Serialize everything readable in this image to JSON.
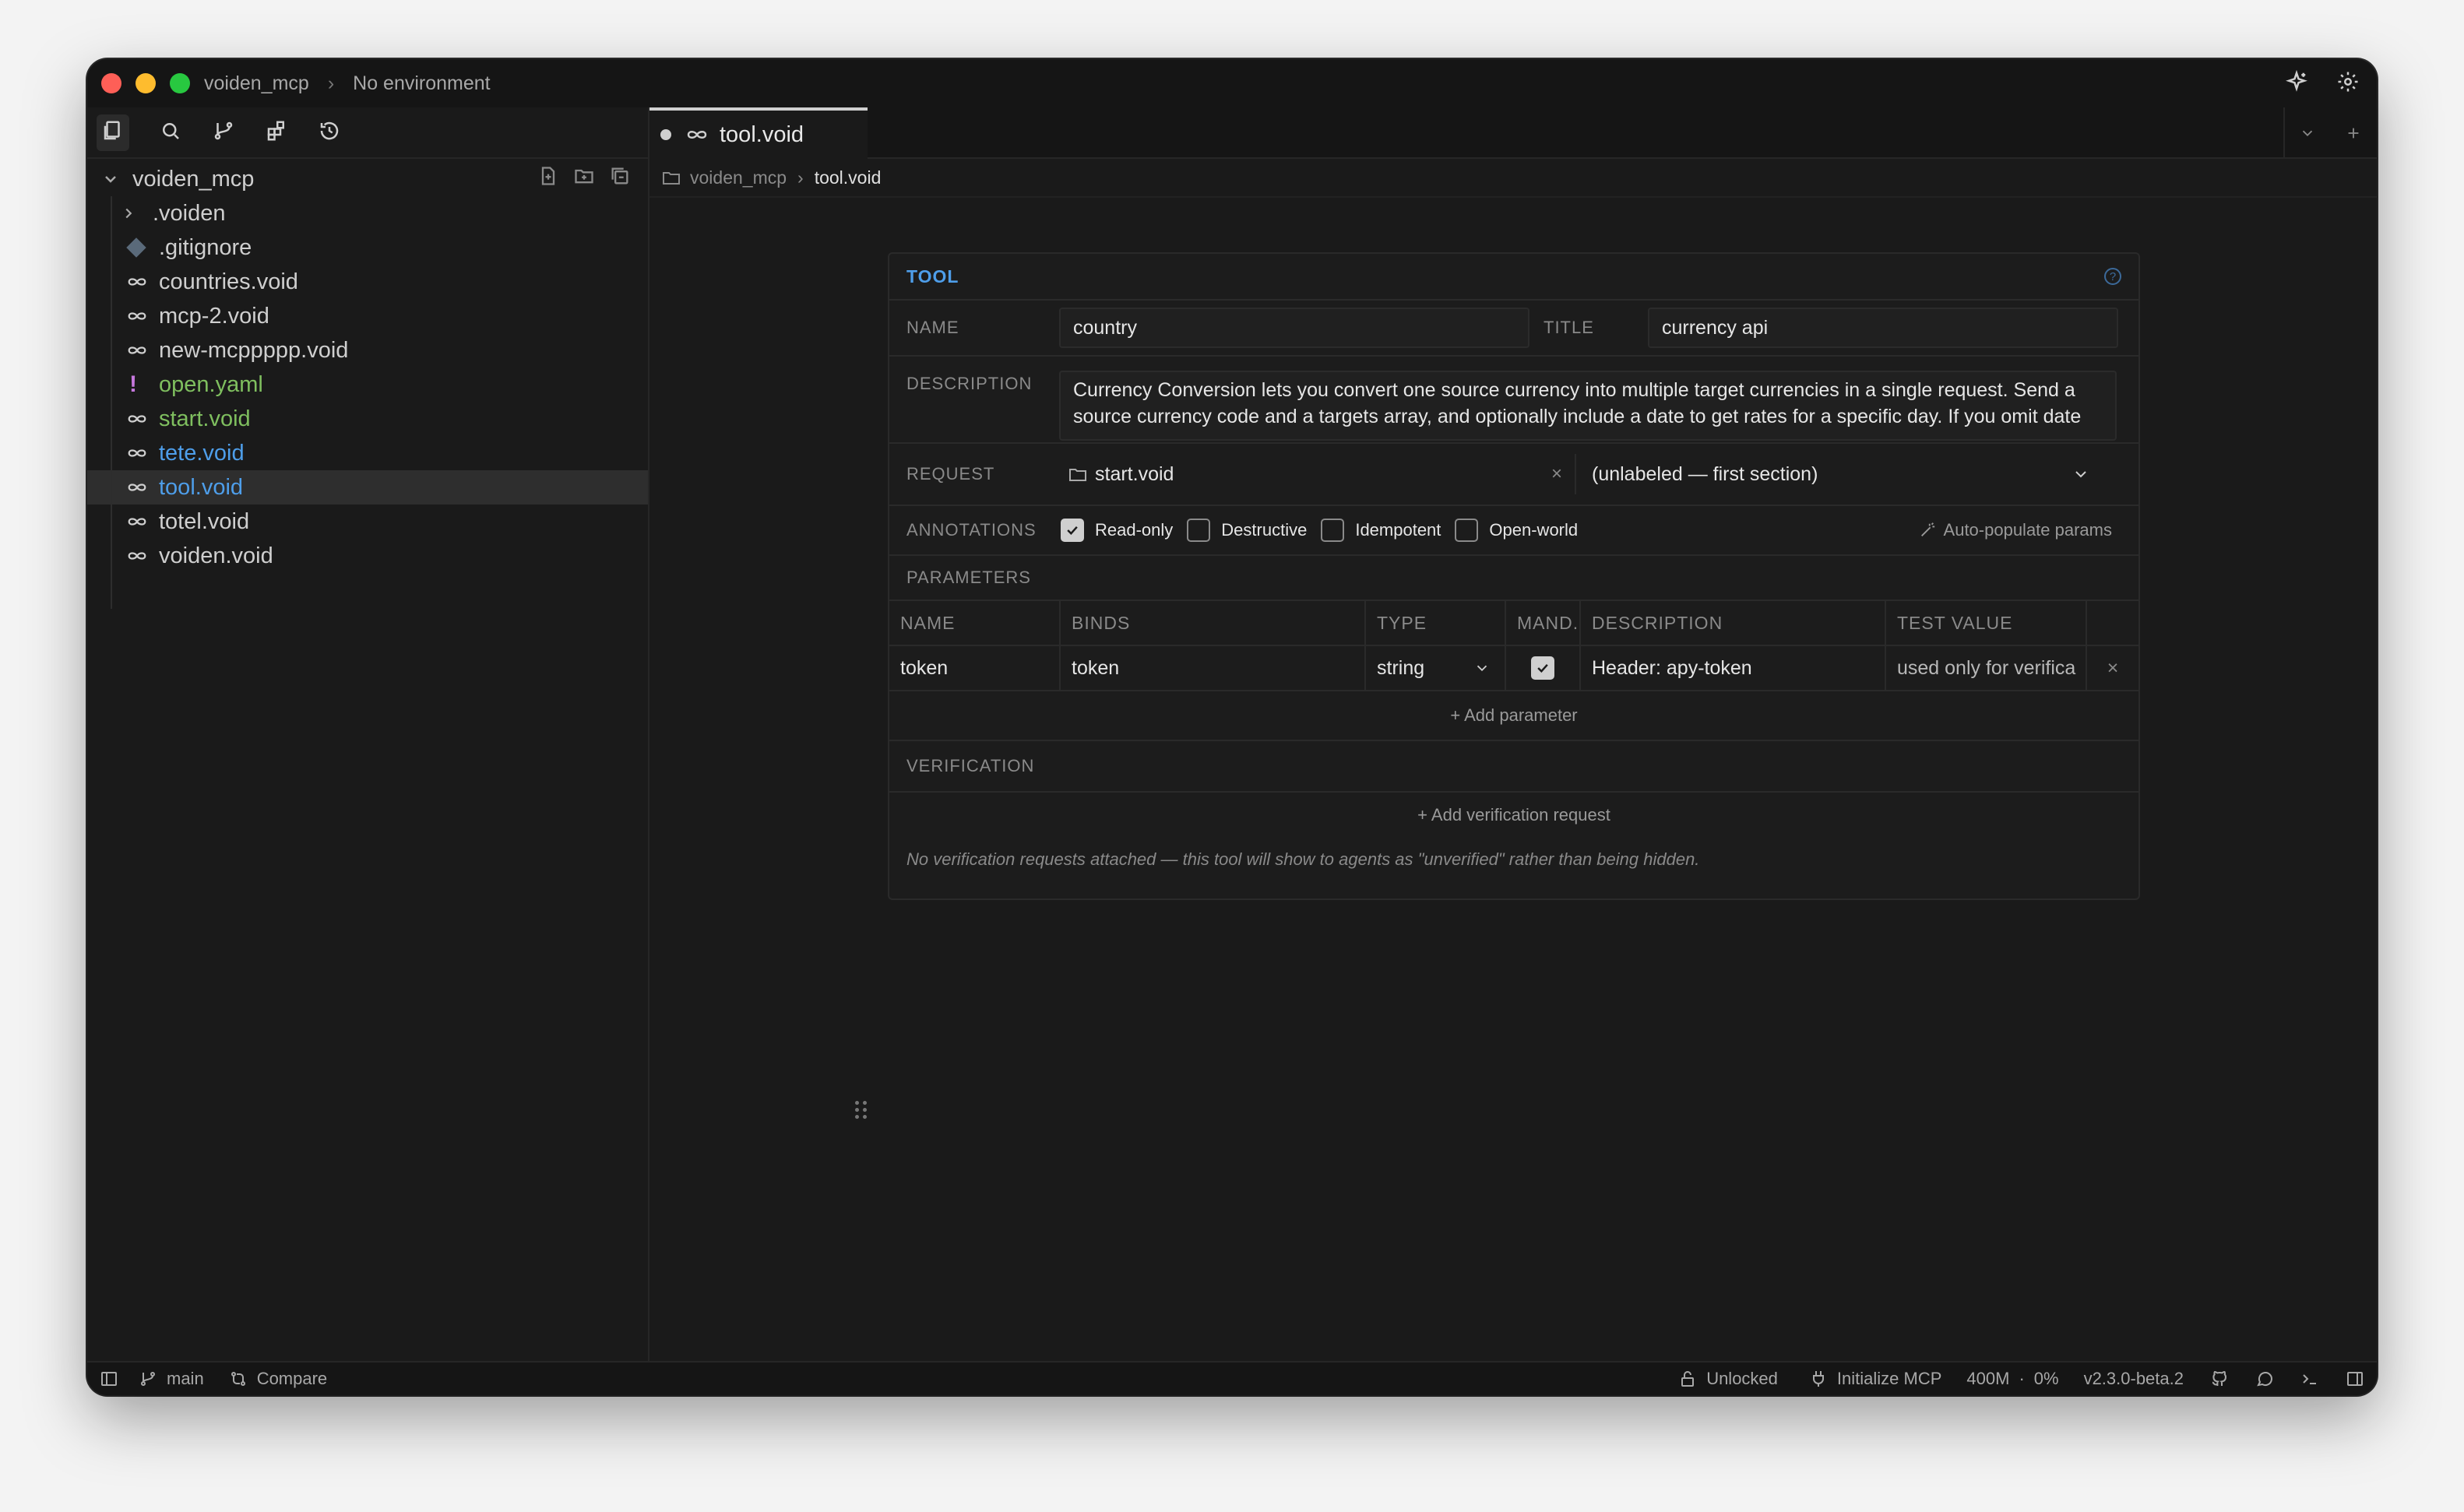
{
  "titlebar": {
    "project": "voiden_mcp",
    "environment": "No environment"
  },
  "sidebar": {
    "root": "voiden_mcp",
    "items": [
      {
        "label": ".voiden",
        "kind": "folder"
      },
      {
        "label": ".gitignore",
        "kind": "git"
      },
      {
        "label": "countries.void",
        "kind": "void"
      },
      {
        "label": "mcp-2.void",
        "kind": "void"
      },
      {
        "label": "new-mcppppp.void",
        "kind": "void"
      },
      {
        "label": "open.yaml",
        "kind": "yaml"
      },
      {
        "label": "start.void",
        "kind": "void"
      },
      {
        "label": "tete.void",
        "kind": "void"
      },
      {
        "label": "tool.void",
        "kind": "void"
      },
      {
        "label": "totel.void",
        "kind": "void"
      },
      {
        "label": "voiden.void",
        "kind": "void"
      }
    ]
  },
  "tab": {
    "label": "tool.void"
  },
  "breadcrumb": {
    "folder": "voiden_mcp",
    "file": "tool.void"
  },
  "tool": {
    "header": "TOOL",
    "name_label": "NAME",
    "name_value": "country",
    "title_label": "TITLE",
    "title_value": "currency api",
    "description_label": "DESCRIPTION",
    "description_value": "Currency Conversion lets you convert one source currency into multiple target currencies in a single request. Send a source currency code and a targets array, and optionally include a date to get rates for a specific day. If you omit date",
    "request_label": "REQUEST",
    "request_file": "start.void",
    "request_section": "(unlabeled — first section)",
    "annotations_label": "ANNOTATIONS",
    "annotations": [
      {
        "label": "Read-only",
        "checked": true
      },
      {
        "label": "Destructive",
        "checked": false
      },
      {
        "label": "Idempotent",
        "checked": false
      },
      {
        "label": "Open-world",
        "checked": false
      }
    ],
    "auto_populate": "Auto-populate params",
    "parameters_label": "PARAMETERS",
    "param_headers": [
      "NAME",
      "BINDS",
      "TYPE",
      "MAND.",
      "DESCRIPTION",
      "TEST VALUE"
    ],
    "params": [
      {
        "name": "token",
        "binds": "token",
        "type": "string",
        "mandatory": true,
        "description": "Header: apy-token",
        "test_value": "used only for verifica"
      }
    ],
    "add_parameter": "+ Add parameter",
    "verification_label": "VERIFICATION",
    "add_verification": "+ Add verification request",
    "verification_note": "No verification requests attached — this tool will show to agents as \"unverified\" rather than being hidden."
  },
  "statusbar": {
    "branch": "main",
    "compare": "Compare",
    "lock": "Unlocked",
    "mcp": "Initialize MCP",
    "memory": "400M",
    "cpu": "0%",
    "version": "v2.3.0-beta.2"
  }
}
